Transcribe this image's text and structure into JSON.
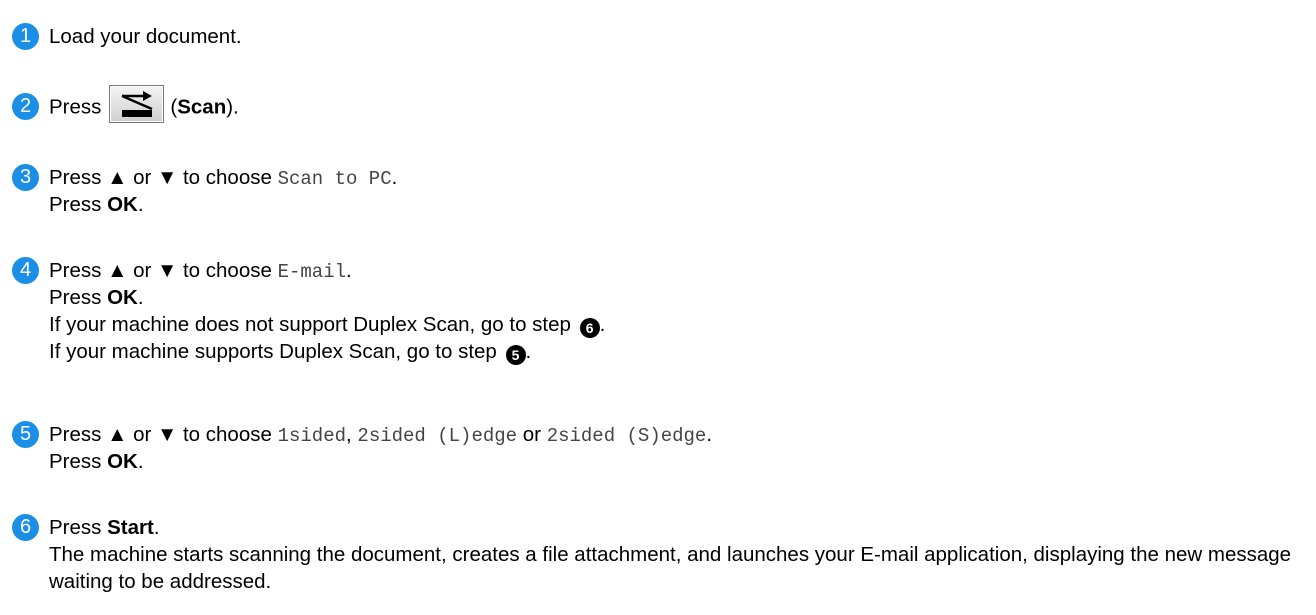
{
  "steps": [
    {
      "number": "1",
      "lines": [
        {
          "text": "Load your document."
        }
      ]
    },
    {
      "number": "2",
      "press": "Press",
      "open": "(",
      "key": "Scan",
      "close": ")."
    },
    {
      "number": "3",
      "press_choose": "Press ▲ or ▼ to choose",
      "option": "Scan to PC",
      "period": ".",
      "press": "Press",
      "ok": "OK",
      "ok_period": "."
    },
    {
      "number": "4",
      "press_choose": "Press ▲ or ▼ to choose",
      "option": "E-mail",
      "period": ".",
      "press": "Press",
      "ok": "OK",
      "ok_period": ".",
      "note1": "If your machine does not support Duplex Scan, go to step",
      "note1_ref": "6",
      "note2": "If your machine supports Duplex Scan, go to step",
      "note2_ref": "5",
      "dot": "."
    },
    {
      "number": "5",
      "press_choose": "Press ▲ or ▼ to choose",
      "opt1": "1sided",
      "comma": ",",
      "opt2": "2sided (L)edge",
      "or": "or",
      "opt3": "2sided (S)edge",
      "period": ".",
      "press": "Press",
      "ok": "OK",
      "ok_period": "."
    },
    {
      "number": "6",
      "press": "Press",
      "start": "Start",
      "period": ".",
      "desc": "The machine starts scanning the document, creates a file attachment, and launches your E-mail application, displaying the new message waiting to be addressed."
    }
  ],
  "icons": {
    "scan_key": "scan-tray-icon"
  },
  "colors": {
    "step_number": "#1b8fe5",
    "text": "#000000",
    "option_text": "#444444"
  }
}
